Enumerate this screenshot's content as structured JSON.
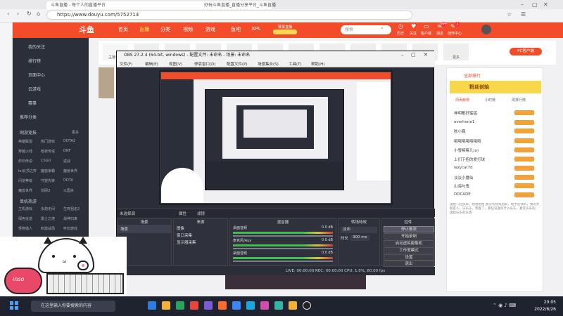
{
  "browser": {
    "tab_title": "斗鱼直播 - 每个人的直播平台",
    "window_title": "好玩斗鱼直播_直播分享平台_斗鱼直播",
    "url": "https://www.douyu.com/5752714",
    "controls": [
      "back",
      "forward",
      "reload",
      "home"
    ]
  },
  "site": {
    "logo": "斗鱼",
    "nav": [
      "首页",
      "直播",
      "分类",
      "视频",
      "游戏",
      "鱼吧",
      "KPL"
    ],
    "promo": "赛事直播",
    "search_placeholder": "搜索",
    "header_icons": [
      "历史",
      "关注",
      "客户端",
      "消息",
      "创作中心"
    ],
    "header_badges": [
      "99+",
      "1"
    ],
    "primary": "#f24c2a",
    "follow_bar": [
      "主播订阅",
      "直播",
      "直播",
      "直播",
      "直播",
      "直播",
      "直播",
      "直播",
      "直播",
      "直播",
      "主播订阅",
      "更多"
    ],
    "pc_button": "PC客户端"
  },
  "sidebar": {
    "items": [
      "我的关注",
      "排行榜",
      "页面中心",
      "云游戏",
      "赛事",
      "推荐分类"
    ],
    "section": "网游竞技",
    "more": "更多",
    "games": [
      [
        "英雄联盟",
        "热门游戏",
        "DOTA2"
      ],
      [
        "穿越火线",
        "暗夜传说",
        "DNF"
      ],
      [
        "炉石传说",
        "CSGO",
        "逆战"
      ],
      [
        "lol云顶之弈",
        "魔兽争霸",
        "魔兽世界"
      ],
      [
        "问道等级",
        "守望先锋",
        "DOTA"
      ],
      [
        "魔兽世界",
        "剑网3",
        "三国杀"
      ]
    ],
    "section2": "单机热游",
    "games2": [
      [
        "主机游戏",
        "永劫无间",
        "生死狙击2"
      ],
      [
        "绿色征途",
        "勇士之境",
        "战神归来"
      ],
      [
        "怪物猎人",
        "刺激战场",
        "怀旧游戏"
      ]
    ]
  },
  "obs": {
    "title": "OBS 27.2.4 (64-bit, windows) - 配置文件: 未命名 - 场景: 未命名",
    "menu": [
      "文件(F)",
      "编辑(E)",
      "视图(V)",
      "停靠窗口(D)",
      "配置文件(P)",
      "场景集合(S)",
      "工具(T)",
      "帮助(H)"
    ],
    "no_source": "未选择源",
    "props": "属性",
    "filters": "滤镜",
    "panels": {
      "scenes": "场景",
      "sources": "来源",
      "mixer": "混音器",
      "transitions": "转场特效",
      "controls": "控件"
    },
    "scene_items": [
      "场景"
    ],
    "source_items": [
      "图像",
      "窗口采集",
      "显示器采集"
    ],
    "mixer_tracks": [
      {
        "name": "桌面音频",
        "db": "0.0 dB"
      },
      {
        "name": "麦克风/Aux",
        "db": "0.0 dB"
      },
      {
        "name": "桌面音频",
        "db": "0.0 dB"
      }
    ],
    "transition": "淡出",
    "duration_label": "时长",
    "duration": "300 ms",
    "control_buttons": [
      "停止推流",
      "开始录制",
      "启动虚拟摄像机",
      "工作室模式",
      "设置",
      "退出"
    ],
    "status": "LIVE: 00:00:00   REC: 00:00:00   CPU: 1.0%, 60.00 fps"
  },
  "right_panel": {
    "title": "全部排行",
    "tabs": [
      "周贡献榜",
      "小时榜",
      "周排行榜"
    ],
    "banner": "粉丝创始",
    "names": [
      "神明都好猛猛",
      "everhone1",
      "陈小巍",
      "哦哦哦哦哦哦哦",
      "小雪嘛嘛几(o)",
      "上们下招的爱打球",
      "lazycat7d",
      "淡淡小播仙",
      "山海与鬼",
      "DDCADE"
    ],
    "announcement": "送给一起快来，哈哈哈哈,我没有找到朋友，给予反馈的，我的大朋友人，乐乐乐，恭喜了，那些说喜欢什么乐乐，喜欢乐乐的，送给乐乐的东西"
  },
  "taskbar": {
    "search_placeholder": "在这里输入你要搜索的内容",
    "icon_colors": [
      "#2f7de1",
      "#f2b233",
      "#29a45b",
      "#e8463b",
      "#7c5cd6",
      "#ff6b2c",
      "#3b86f6",
      "#1ca6e0",
      "#d24cad",
      "#35b5a5",
      "#f2b233",
      "#888888"
    ],
    "time": "20:05",
    "date": "2022/6/26"
  },
  "overlay": {
    "cam_text": "inso"
  }
}
